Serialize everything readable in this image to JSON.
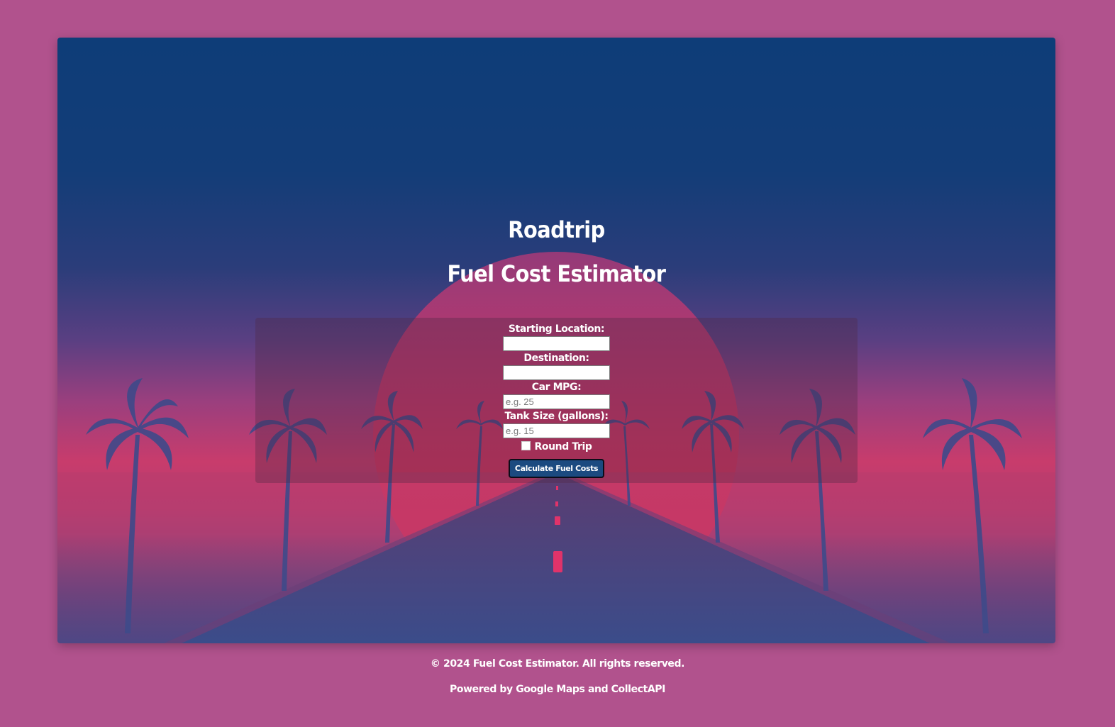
{
  "header": {
    "title": "Roadtrip",
    "subtitle": "Fuel Cost Estimator"
  },
  "form": {
    "start_label": "Starting Location:",
    "start_value": "",
    "start_placeholder": "",
    "destination_label": "Destination:",
    "destination_value": "",
    "destination_placeholder": "",
    "mpg_label": "Car MPG:",
    "mpg_placeholder": "e.g. 25",
    "tank_label": "Tank Size (gallons):",
    "tank_placeholder": "e.g. 15",
    "round_trip_label": "Round Trip",
    "round_trip_checked": false,
    "submit_label": "Calculate Fuel Costs"
  },
  "footer": {
    "copyright": "© 2024 Fuel Cost Estimator. All rights reserved.",
    "powered_by": "Powered by Google Maps and CollectAPI"
  },
  "colors": {
    "page_background": "#b1528d",
    "sky_top": "#0e3d78",
    "sun": "#d8335f",
    "button": "#1b4a80"
  }
}
